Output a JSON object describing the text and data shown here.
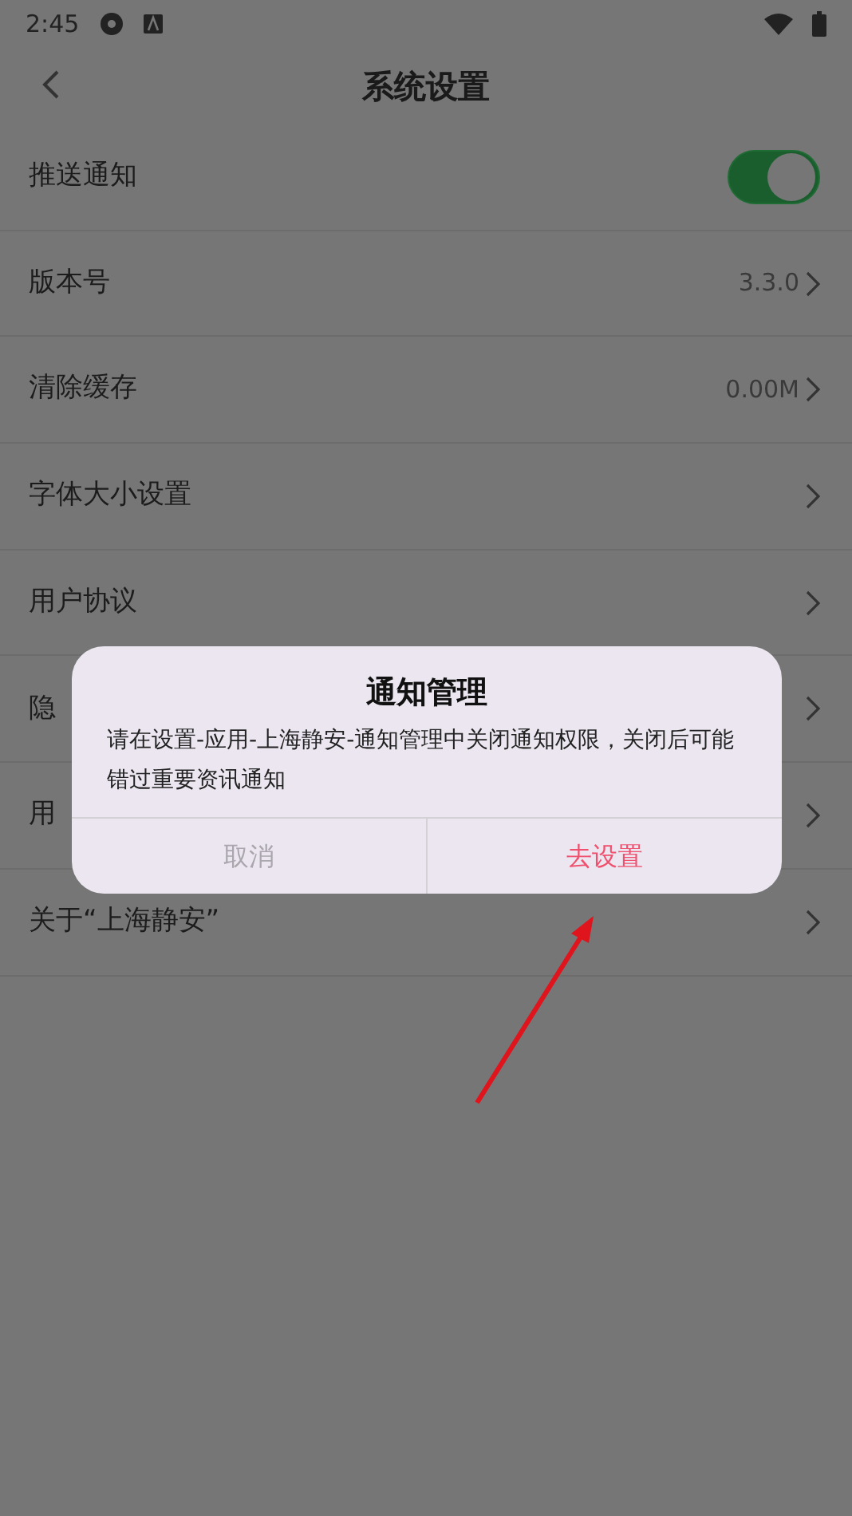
{
  "status_bar": {
    "time": "2:45"
  },
  "header": {
    "title": "系统设置"
  },
  "settings": [
    {
      "kind": "toggle",
      "label": "推送通知",
      "on": true
    },
    {
      "kind": "link",
      "label": "版本号",
      "value": "3.3.0"
    },
    {
      "kind": "link",
      "label": "清除缓存",
      "value": "0.00M"
    },
    {
      "kind": "link",
      "label": "字体大小设置"
    },
    {
      "kind": "link",
      "label": "用户协议"
    },
    {
      "kind": "link",
      "label": "隐"
    },
    {
      "kind": "link",
      "label": "用"
    },
    {
      "kind": "link",
      "label": "关于“上海静安”"
    }
  ],
  "dialog": {
    "title": "通知管理",
    "message": "请在设置-应用-上海静安-通知管理中关闭通知权限，关闭后可能错过重要资讯通知",
    "buttons": [
      {
        "label": "取消",
        "kind": "cancel"
      },
      {
        "label": "去设置",
        "kind": "confirm"
      }
    ]
  }
}
